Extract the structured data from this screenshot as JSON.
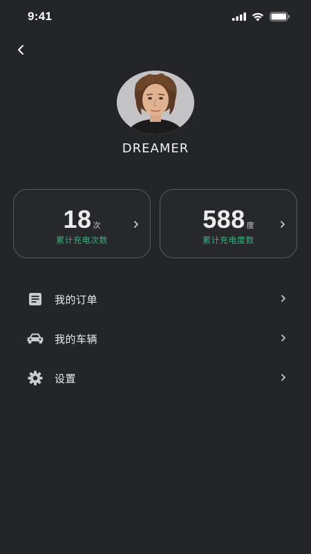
{
  "status_bar": {
    "time": "9:41"
  },
  "nav": {
    "back_icon": "chevron-left-icon"
  },
  "profile": {
    "avatar_icon": "user-avatar",
    "username": "DREAMER"
  },
  "stats": [
    {
      "value": "18",
      "unit": "次",
      "label": "累计充电次数"
    },
    {
      "value": "588",
      "unit": "度",
      "label": "累计充电度数"
    }
  ],
  "menu": [
    {
      "icon": "document-icon",
      "label": "我的订单"
    },
    {
      "icon": "car-icon",
      "label": "我的车辆"
    },
    {
      "icon": "gear-icon",
      "label": "设置"
    }
  ],
  "colors": {
    "background": "#242528",
    "accent": "#2fb37d",
    "card_border": "#5b5c60",
    "text": "#ececec"
  }
}
